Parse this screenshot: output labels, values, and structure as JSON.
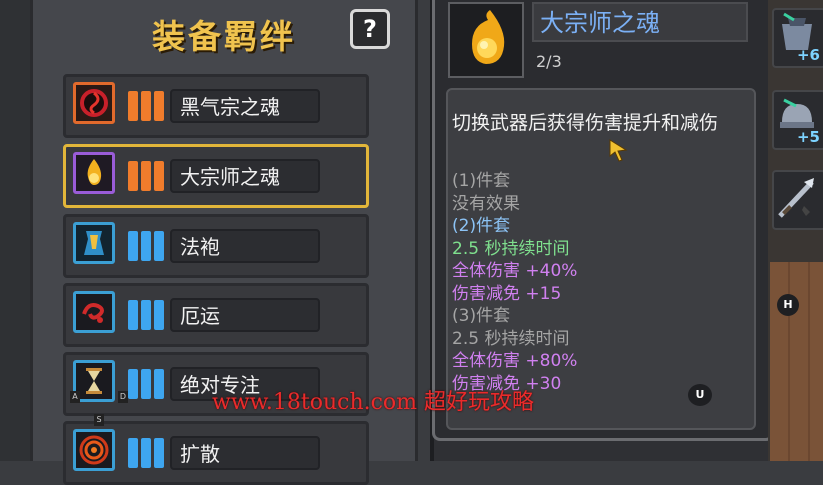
{
  "left_panel": {
    "title": "装备羁绊",
    "help_label": "?",
    "sets": [
      {
        "name": "黑气宗之魂",
        "icon": "black-qi-swirl-icon",
        "bar_color": "orange",
        "selected": false
      },
      {
        "name": "大宗师之魂",
        "icon": "grandmaster-flame-icon",
        "bar_color": "orange",
        "selected": true
      },
      {
        "name": "法袍",
        "icon": "robe-icon",
        "bar_color": "blue",
        "selected": false
      },
      {
        "name": "厄运",
        "icon": "misfortune-swirl-icon",
        "bar_color": "blue",
        "selected": false
      },
      {
        "name": "绝对专注",
        "icon": "hourglass-icon",
        "bar_color": "blue",
        "selected": false
      },
      {
        "name": "扩散",
        "icon": "target-ring-icon",
        "bar_color": "blue",
        "selected": false
      }
    ]
  },
  "detail": {
    "name": "大宗师之魂",
    "count": "2/3",
    "description": "切换武器后获得伤害提升和减伤",
    "lines": [
      {
        "text": "(1)件套",
        "tone": "gray"
      },
      {
        "text": "没有效果",
        "tone": "gray"
      },
      {
        "text": "(2)件套",
        "tone": "blue"
      },
      {
        "text": "2.5 秒持续时间",
        "tone": "green"
      },
      {
        "text": "全体伤害 +40%",
        "tone": "purple"
      },
      {
        "text": "伤害减免 +15",
        "tone": "purple"
      },
      {
        "text": "(3)件套",
        "tone": "gray"
      },
      {
        "text": "2.5 秒持续时间",
        "tone": "gray"
      },
      {
        "text": "全体伤害 +80%",
        "tone": "purple"
      },
      {
        "text": "伤害减免 +30",
        "tone": "purple"
      }
    ],
    "hint_key": "U"
  },
  "equipment_slots": [
    {
      "badge": "+6"
    },
    {
      "badge": "+5"
    },
    {
      "badge": ""
    }
  ],
  "h_key": "H",
  "key_hints": [
    "A",
    "D",
    "S"
  ],
  "watermark": "www.18touch.com 超好玩攻略",
  "colors": {
    "title": "#f0c34e",
    "item_name": "#7bb0f5",
    "selected_border": "#e2b63a",
    "orange_bar": "#f07c2c",
    "blue_bar": "#3ea6f0",
    "purple_stat": "#d080f0",
    "green_stat": "#7fe08e"
  }
}
